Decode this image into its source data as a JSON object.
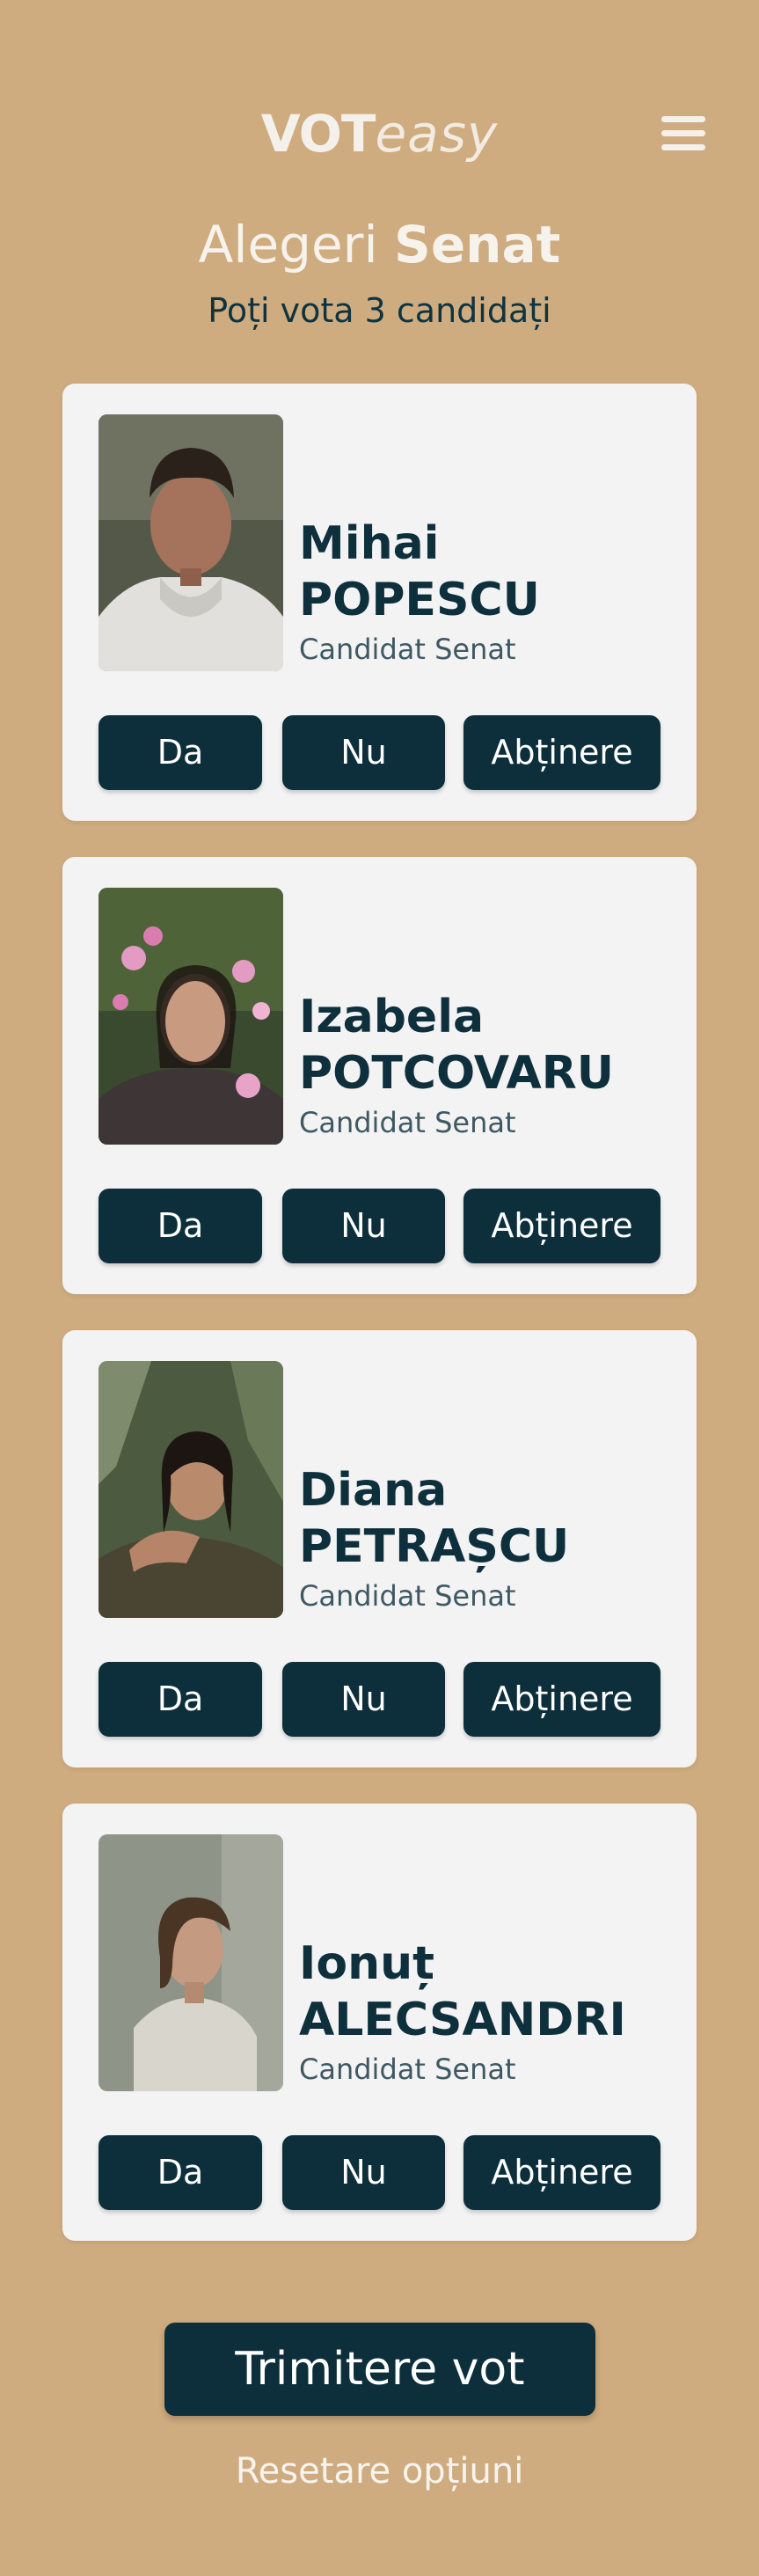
{
  "header": {
    "logo_bold": "VOT",
    "logo_light": "easy",
    "menu_icon": "hamburger-menu-icon"
  },
  "page": {
    "title_light": "Alegeri ",
    "title_bold": "Senat",
    "subtitle": "Poți vota 3 candidați"
  },
  "candidates": [
    {
      "first_name": "Mihai",
      "last_name": "POPESCU",
      "role": "Candidat Senat"
    },
    {
      "first_name": "Izabela",
      "last_name": "POTCOVARU",
      "role": "Candidat Senat"
    },
    {
      "first_name": "Diana",
      "last_name": "PETRAȘCU",
      "role": "Candidat Senat"
    },
    {
      "first_name": "Ionuț",
      "last_name": "ALECSANDRI",
      "role": "Candidat Senat"
    }
  ],
  "vote_options": {
    "yes": "Da",
    "no": "Nu",
    "abstain": "Abținere"
  },
  "actions": {
    "submit": "Trimitere vot",
    "reset": "Resetare opțiuni"
  },
  "colors": {
    "background": "#cfac7f",
    "primary": "#0c2f3b",
    "card": "#f3f3f4"
  }
}
